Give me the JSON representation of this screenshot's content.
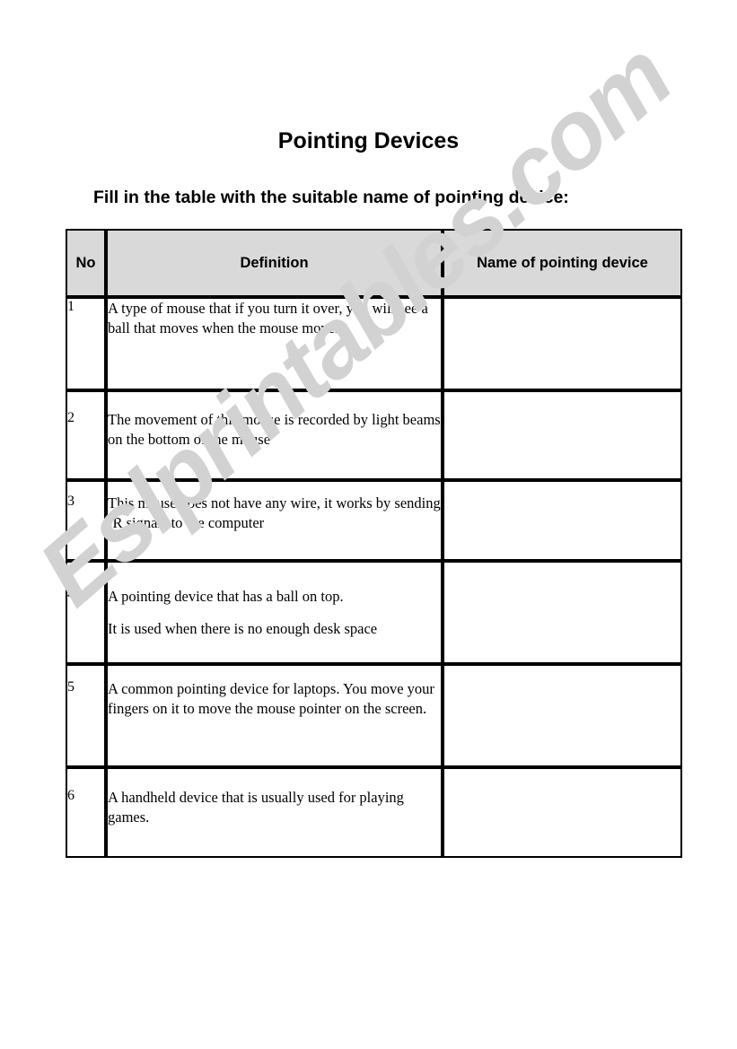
{
  "document": {
    "title": "Pointing Devices",
    "instruction": "Fill in the table with the suitable name of pointing device:"
  },
  "watermark": {
    "text": "Eslprintables.com",
    "color": "#d2d2d2"
  },
  "table": {
    "headers": {
      "no": "No",
      "definition": "Definition",
      "name": "Name of pointing device"
    },
    "header_background": "#d9d9d9",
    "border_color": "#000000",
    "rows": [
      {
        "no": "1",
        "definition_lines": [
          "A type of mouse that if you turn it over, you will see a ball that moves when the mouse moves."
        ],
        "answer": ""
      },
      {
        "no": "2",
        "definition_lines": [
          "The movement of this mouse is recorded by light beams on the bottom of the mouse"
        ],
        "answer": ""
      },
      {
        "no": "3",
        "definition_lines": [
          "This mouse does not have any wire, it works by sending IR signals to the computer"
        ],
        "answer": ""
      },
      {
        "no": "4",
        "definition_lines": [
          "A pointing device that has a ball on top.",
          "It is used when there is no enough desk space"
        ],
        "answer": ""
      },
      {
        "no": "5",
        "definition_lines": [
          "A common pointing device for laptops. You move your fingers on it to move the mouse pointer on the screen."
        ],
        "answer": ""
      },
      {
        "no": "6",
        "definition_lines": [
          "A handheld device that is usually used for playing games."
        ],
        "answer": ""
      }
    ]
  }
}
